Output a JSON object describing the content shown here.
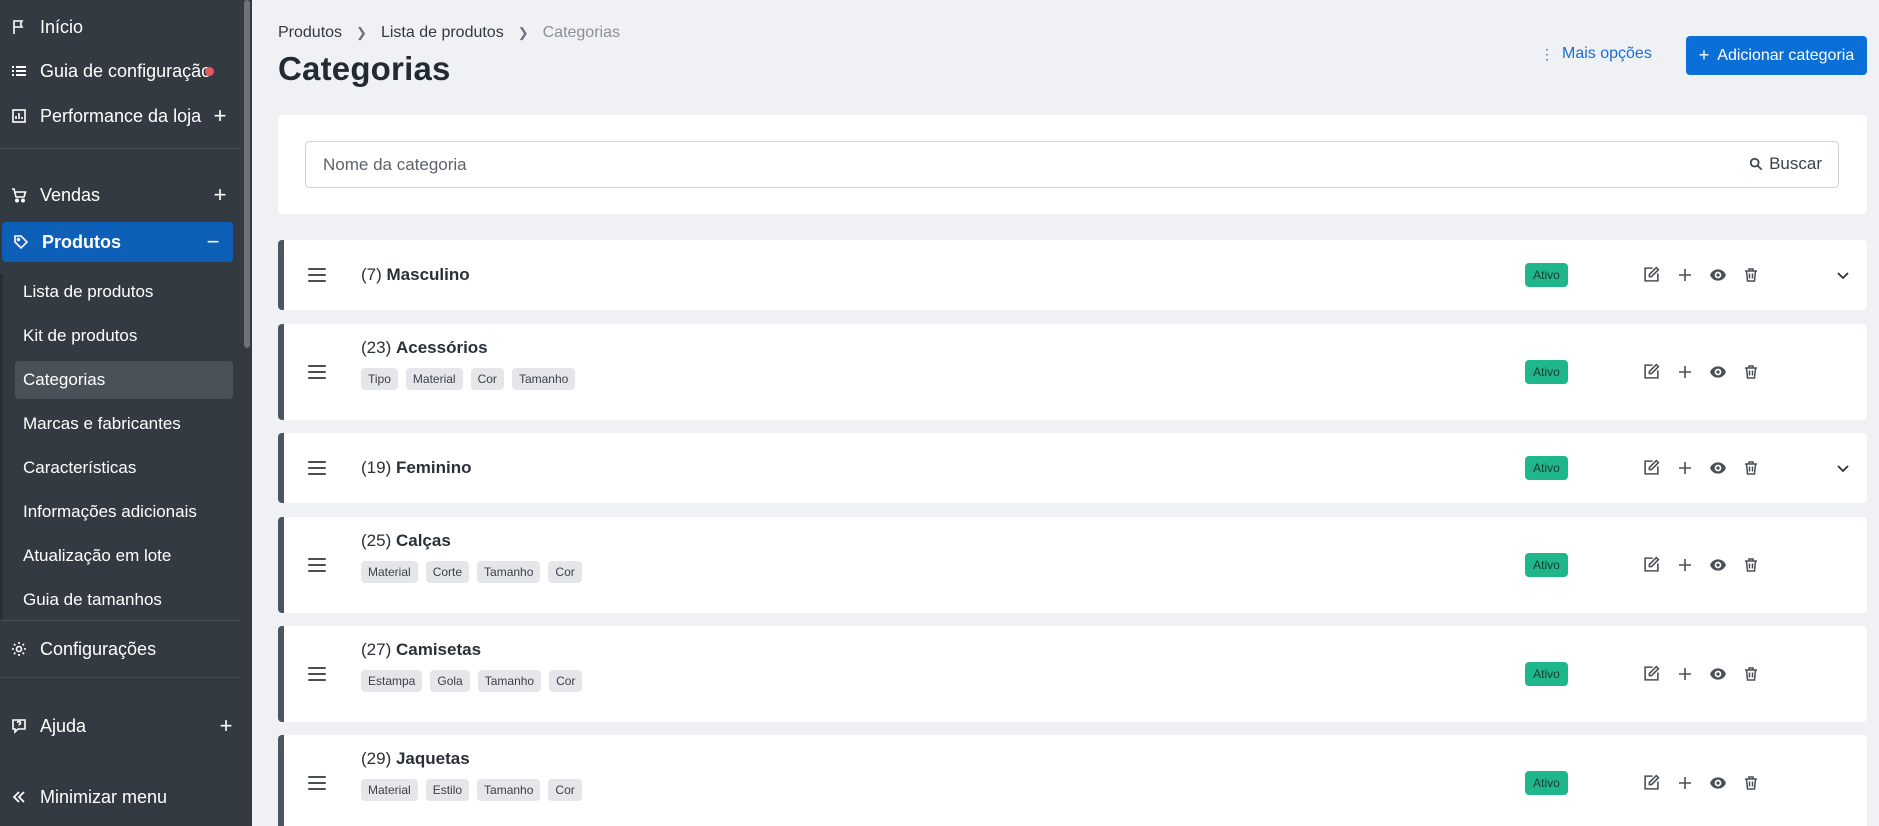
{
  "sidebar": {
    "items": {
      "inicio": "Início",
      "guia": "Guia de configuração",
      "performance": "Performance da loja",
      "vendas": "Vendas",
      "produtos": "Produtos",
      "configuracoes": "Configurações",
      "ajuda": "Ajuda",
      "minimizar": "Minimizar menu"
    },
    "plus_symbol": "+",
    "minus_symbol": "−",
    "sub_items": [
      "Lista de produtos",
      "Kit de produtos",
      "Categorias",
      "Marcas e fabricantes",
      "Características",
      "Informações adicionais",
      "Atualização em lote",
      "Guia de tamanhos"
    ],
    "selected_sub": "Categorias"
  },
  "breadcrumb": {
    "items": [
      "Produtos",
      "Lista de produtos",
      "Categorias"
    ]
  },
  "page": {
    "title": "Categorias",
    "more_options": "Mais opções",
    "add_button": "Adicionar categoria"
  },
  "search": {
    "placeholder": "Nome da categoria",
    "button": "Buscar"
  },
  "categories": [
    {
      "id": "(7)",
      "name": "Masculino",
      "tags": [],
      "status": "Ativo",
      "expandable": true
    },
    {
      "id": "(23)",
      "name": "Acessórios",
      "tags": [
        "Tipo",
        "Material",
        "Cor",
        "Tamanho"
      ],
      "status": "Ativo",
      "expandable": false
    },
    {
      "id": "(19)",
      "name": "Feminino",
      "tags": [],
      "status": "Ativo",
      "expandable": true
    },
    {
      "id": "(25)",
      "name": "Calças",
      "tags": [
        "Material",
        "Corte",
        "Tamanho",
        "Cor"
      ],
      "status": "Ativo",
      "expandable": false
    },
    {
      "id": "(27)",
      "name": "Camisetas",
      "tags": [
        "Estampa",
        "Gola",
        "Tamanho",
        "Cor"
      ],
      "status": "Ativo",
      "expandable": false
    },
    {
      "id": "(29)",
      "name": "Jaquetas",
      "tags": [
        "Material",
        "Estilo",
        "Tamanho",
        "Cor"
      ],
      "status": "Ativo",
      "expandable": false
    }
  ],
  "colors": {
    "sidebar_bg": "#343a42",
    "active_bg": "#0e5fb8",
    "primary": "#0b6fd8",
    "badge": "#20b68c",
    "alert_dot": "#e25a62"
  }
}
